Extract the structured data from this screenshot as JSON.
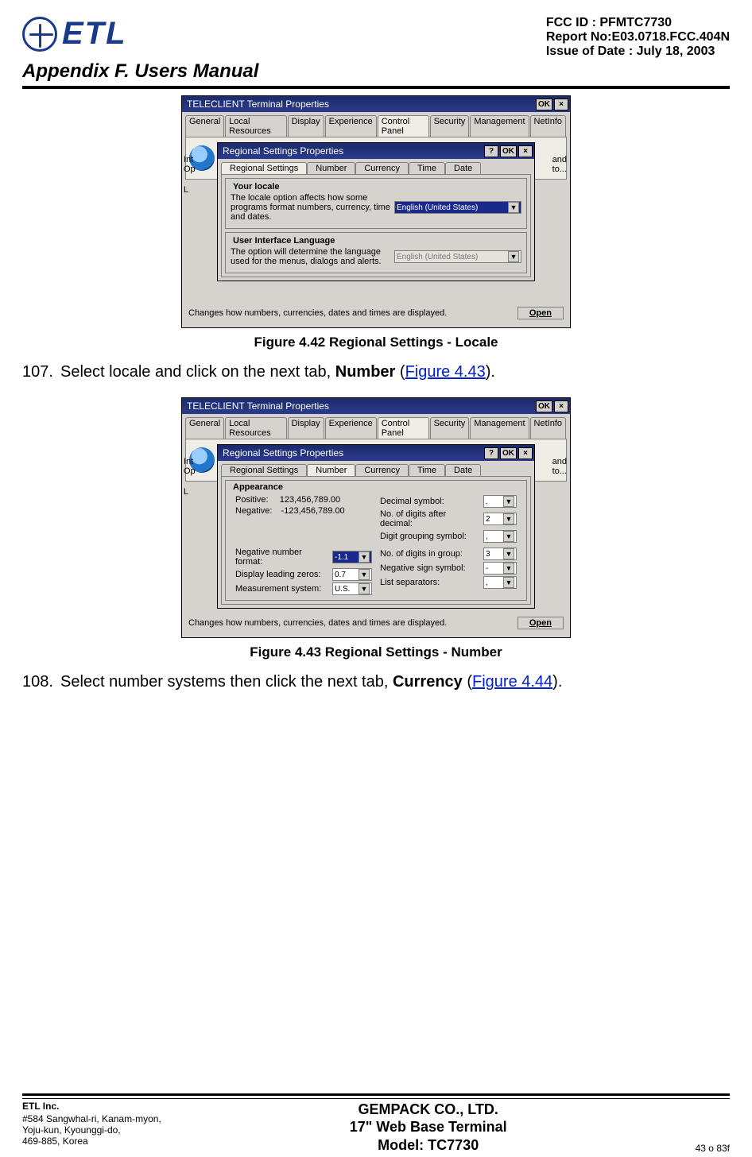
{
  "header": {
    "logo_text": "ETL",
    "fcc": "FCC ID : PFMTC7730",
    "report": "Report No:E03.0718.FCC.404N",
    "issue": "Issue of Date : July 18, 2003",
    "appendix": "Appendix F.  Users Manual"
  },
  "figures": {
    "fig42_caption": "Figure 4.42       Regional Settings - Locale",
    "fig43_caption": "Figure 4.43       Regional Settings - Number"
  },
  "instructions": {
    "step107_num": "107.",
    "step107_pre": "Select locale and click on the next tab, ",
    "step107_bold": "Number",
    "step107_open": " (",
    "step107_link": "Figure 4.43",
    "step107_close": ").",
    "step108_num": "108.",
    "step108_pre": "Select number systems then click the next tab, ",
    "step108_bold": "Currency",
    "step108_open": " (",
    "step108_link": "Figure 4.44",
    "step108_close": ")."
  },
  "outer_window": {
    "title": "TELECLIENT  Terminal Properties",
    "ok": "OK",
    "close": "×",
    "tabs": [
      "General",
      "Local Resources",
      "Display",
      "Experience",
      "Control Panel",
      "Security",
      "Management",
      "NetInfo"
    ],
    "active_tab_index": 4,
    "status": "Changes how numbers, currencies, dates and times are displayed.",
    "open_btn": "Open",
    "side1": "Int",
    "side2": "Op",
    "side3": "L",
    "side_r1": "and",
    "side_r2": "to..."
  },
  "dlg_locale": {
    "title": "Regional Settings Properties",
    "help": "?",
    "ok": "OK",
    "close": "×",
    "tabs": [
      "Regional Settings",
      "Number",
      "Currency",
      "Time",
      "Date"
    ],
    "active_tab_index": 0,
    "legend_locale": "Your locale",
    "locale_desc": "The locale option affects how some programs format numbers, currency, time and dates.",
    "locale_value": "English (United States)",
    "legend_uilang": "User Interface Language",
    "uilang_desc": "The option will determine the language used for the menus, dialogs and alerts.",
    "uilang_value": "English (United States)"
  },
  "dlg_number": {
    "title": "Regional Settings Properties",
    "help": "?",
    "ok": "OK",
    "close": "×",
    "tabs": [
      "Regional Settings",
      "Number",
      "Currency",
      "Time",
      "Date"
    ],
    "active_tab_index": 1,
    "legend_appearance": "Appearance",
    "positive_label": "Positive:",
    "positive_value": "123,456,789.00",
    "negative_label": "Negative:",
    "negative_value": "-123,456,789.00",
    "neg_fmt_label": "Negative number format:",
    "neg_fmt_value": "-1.1",
    "zero_label": "Display leading zeros:",
    "zero_value": "0.7",
    "meas_label": "Measurement system:",
    "meas_value": "U.S.",
    "dec_sym_label": "Decimal symbol:",
    "dec_sym_value": ".",
    "dec_digits_label": "No. of digits after decimal:",
    "dec_digits_value": "2",
    "grp_sym_label": "Digit grouping symbol:",
    "grp_sym_value": ",",
    "grp_num_label": "No. of digits in group:",
    "grp_num_value": "3",
    "neg_sign_label": "Negative sign symbol:",
    "neg_sign_value": "-",
    "list_sep_label": "List separators:",
    "list_sep_value": ","
  },
  "footer": {
    "etl": "ETL Inc.",
    "addr1": "#584 Sangwhal-ri, Kanam-myon,",
    "addr2": "Yoju-kun, Kyounggi-do,",
    "addr3": "469-885, Korea",
    "center1": "GEMPACK CO., LTD.",
    "center2": "17\" Web Base Terminal",
    "center3": "Model: TC7730",
    "pagenum": "43 o 83f"
  }
}
